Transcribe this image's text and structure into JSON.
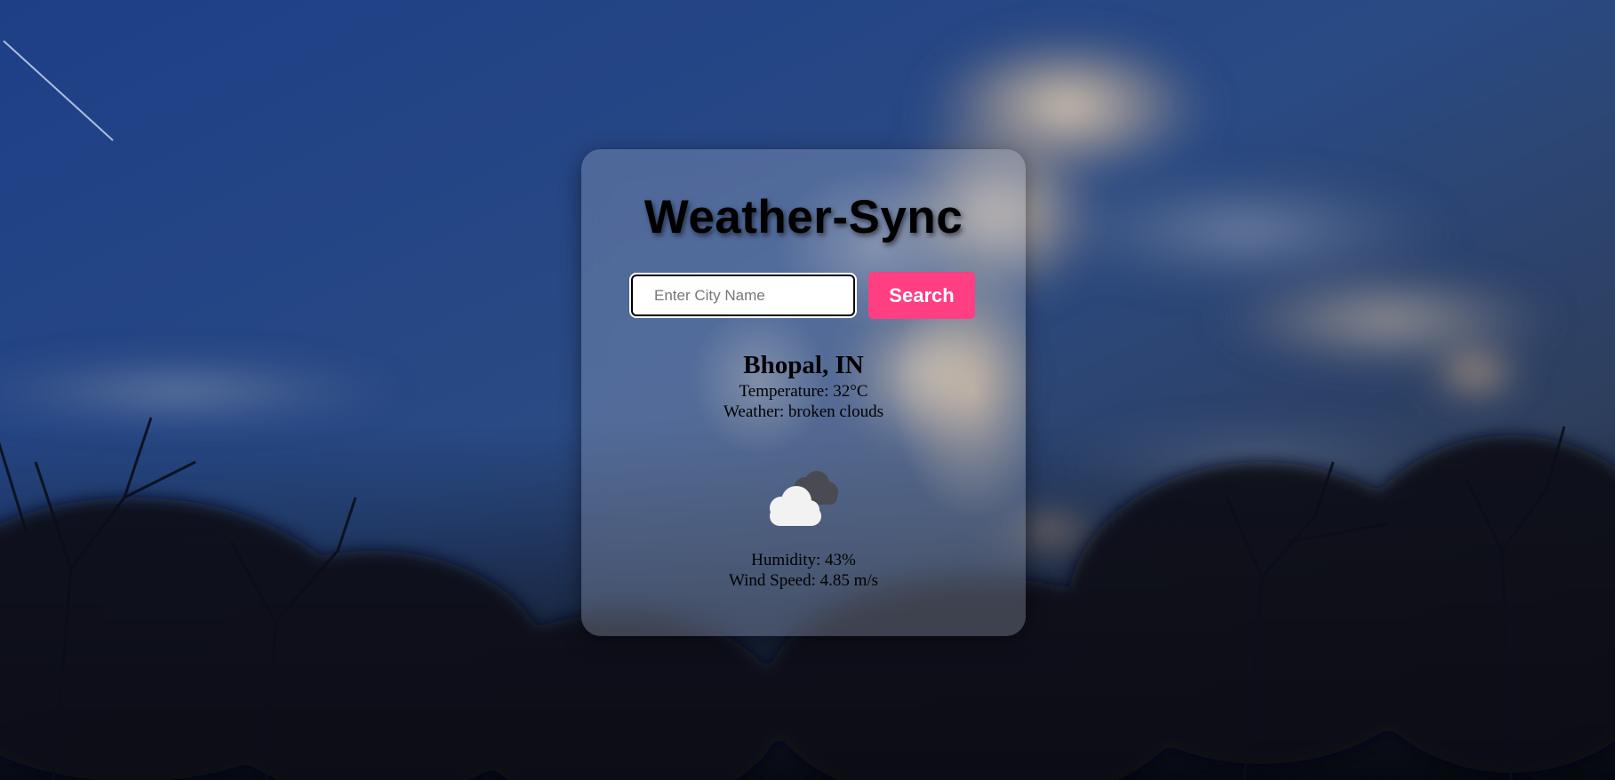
{
  "app": {
    "title": "Weather-Sync"
  },
  "search": {
    "placeholder": "Enter City Name",
    "value": "",
    "button_label": "Search"
  },
  "weather": {
    "location": "Bhopal, IN",
    "temperature": "Temperature: 32°C",
    "description": "Weather: broken clouds",
    "icon": "broken-clouds-icon",
    "humidity": "Humidity: 43%",
    "wind_speed": "Wind Speed: 4.85 m/s"
  },
  "colors": {
    "accent": "#ff3f82",
    "title_text": "#000000",
    "button_text": "#ffffff"
  }
}
